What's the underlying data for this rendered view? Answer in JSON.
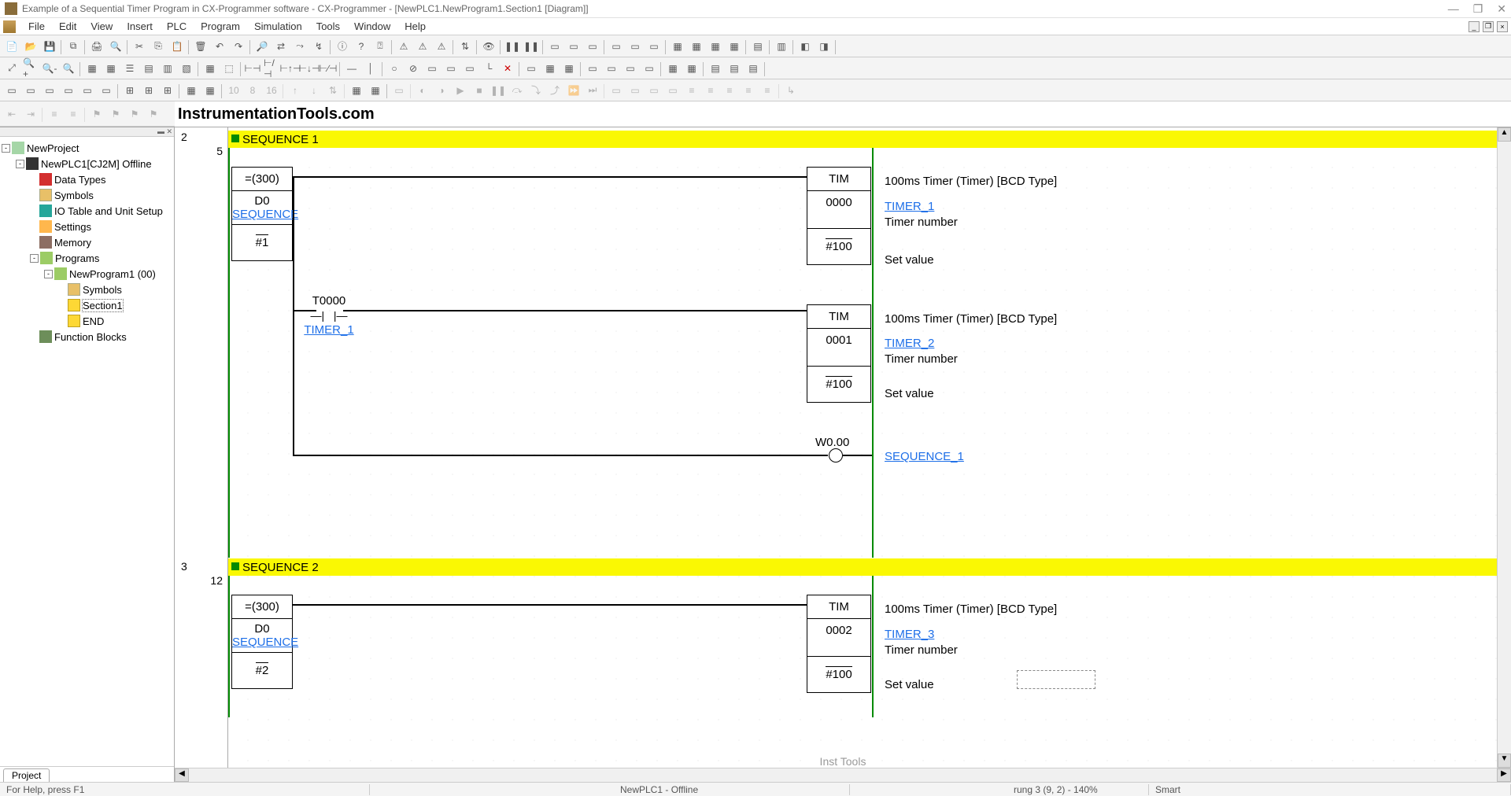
{
  "title": "Example of a Sequential Timer Program in CX-Programmer software - CX-Programmer - [NewPLC1.NewProgram1.Section1 [Diagram]]",
  "menus": [
    "File",
    "Edit",
    "View",
    "Insert",
    "PLC",
    "Program",
    "Simulation",
    "Tools",
    "Window",
    "Help"
  ],
  "watermark": "InstrumentationTools.com",
  "tree": {
    "root": "NewProject",
    "plc": "NewPLC1[CJ2M] Offline",
    "dataTypes": "Data Types",
    "symbols": "Symbols",
    "ioTable": "IO Table and Unit Setup",
    "settings": "Settings",
    "memory": "Memory",
    "programs": "Programs",
    "program1": "NewProgram1 (00)",
    "pSymbols": "Symbols",
    "section1": "Section1",
    "end": "END",
    "fb": "Function Blocks"
  },
  "sidebarTab": "Project",
  "rung": {
    "r2": "2",
    "r2s": "5",
    "r3": "3",
    "r3s": "12"
  },
  "seq1": "SEQUENCE 1",
  "seq2": "SEQUENCE 2",
  "block_eq": {
    "op": "=(300)",
    "d0": "D0",
    "seq": "SEQUENCE",
    "v1": "#1",
    "v2": "#2"
  },
  "tim": {
    "label": "TIM",
    "n0": "0000",
    "n1": "0001",
    "n2": "0002",
    "sv": "#100"
  },
  "contact": {
    "addr": "T0000",
    "name": "TIMER_1"
  },
  "coil": {
    "addr": "W0.00",
    "name": "SEQUENCE_1"
  },
  "desc": {
    "timType": "100ms Timer (Timer) [BCD Type]",
    "t1": "TIMER_1",
    "t2": "TIMER_2",
    "t3": "TIMER_3",
    "tNum": "Timer number",
    "setVal": "Set value"
  },
  "status": {
    "help": "For Help, press F1",
    "tool": "Inst Tools",
    "plc": "NewPLC1 - Offline",
    "rung": "rung 3 (9, 2) - 140%",
    "mode": "Smart"
  }
}
